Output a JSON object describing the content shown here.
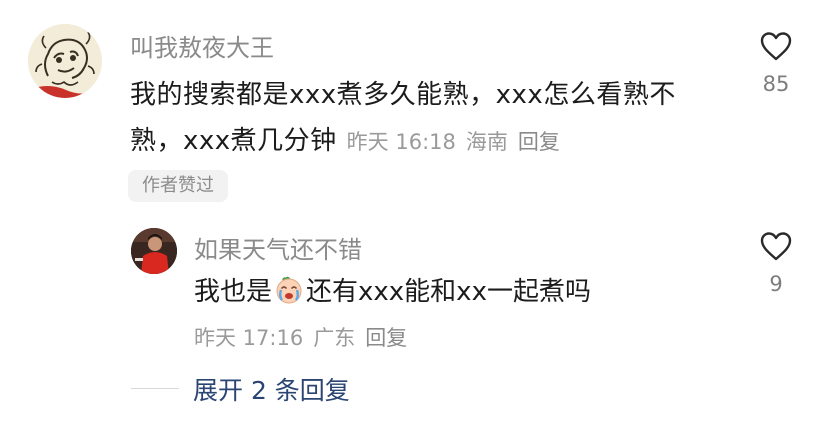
{
  "comment": {
    "username": "叫我敖夜大王",
    "text": "我的搜索都是xxx煮多久能熟，xxx怎么看熟不熟，xxx煮几分钟",
    "time": "昨天 16:18",
    "location": "海南",
    "reply_label": "回复",
    "badge": "作者赞过",
    "like_icon": "heart-outline",
    "like_count": "85"
  },
  "reply": {
    "username": "如果天气还不错",
    "text_before_emoji": "我也是",
    "emoji": "crying-face-emoji",
    "text_after_emoji": "还有xxx能和xx一起煮吗",
    "time": "昨天 17:16",
    "location": "广东",
    "reply_label": "回复",
    "like_icon": "heart-outline",
    "like_count": "9"
  },
  "expand": {
    "label": "展开 2 条回复"
  },
  "colors": {
    "username": "#8a8a8a",
    "meta": "#9a9a9a",
    "expand_link": "#2b4572",
    "badge_bg": "#f2f2f2"
  }
}
